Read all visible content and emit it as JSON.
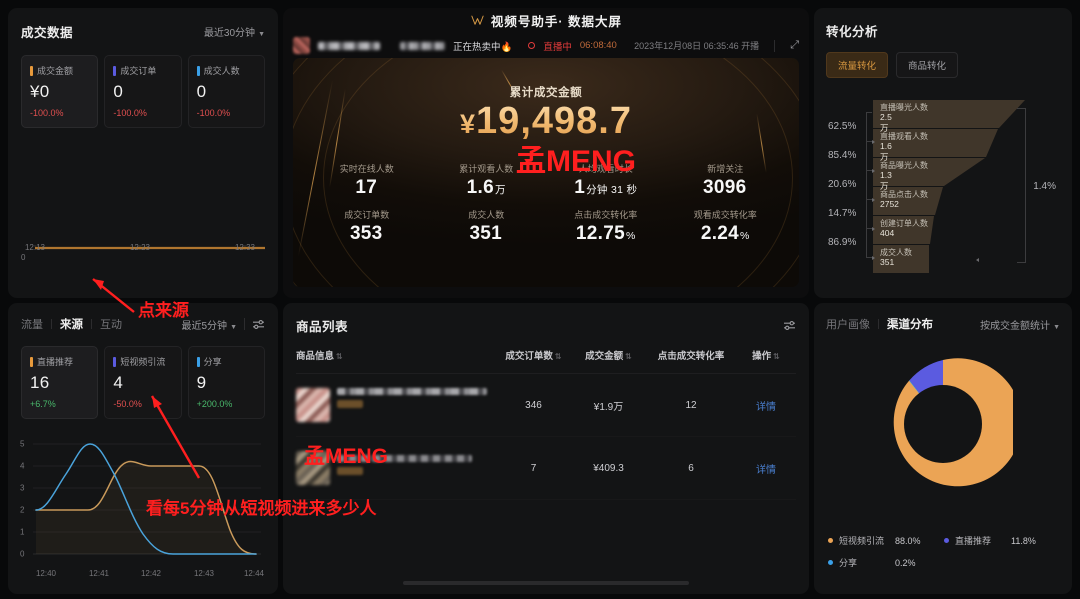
{
  "deal": {
    "title": "成交数据",
    "range": "最近30分钟",
    "cards": [
      {
        "label": "成交金额",
        "value": "¥0",
        "delta": "-100.0%",
        "dir": "down",
        "color": "#e89a3c"
      },
      {
        "label": "成交订单",
        "value": "0",
        "delta": "-100.0%",
        "dir": "down",
        "color": "#5b5be0"
      },
      {
        "label": "成交人数",
        "value": "0",
        "delta": "-100.0%",
        "dir": "down",
        "color": "#3aa0e8"
      }
    ],
    "spark_zero": "0",
    "spark_ticks": [
      "12:13",
      "12:23",
      "12:33"
    ]
  },
  "screen": {
    "brand": "视频号助手·  数据大屏",
    "hot_text": "正在热卖中🔥",
    "live_state": "直播中",
    "live_time": "06:08:40",
    "start_time": "2023年12月08日 06:35:46 开播",
    "gmv_label": "累计成交金额",
    "gmv_currency": "¥",
    "gmv_value": "19,498.7",
    "metrics": [
      {
        "label": "实时在线人数",
        "value": "17",
        "unit": ""
      },
      {
        "label": "累计观看人数",
        "value": "1.6",
        "unit": "万"
      },
      {
        "label": "人均观看时长",
        "value": "1",
        "unit": "分钟 31 秒"
      },
      {
        "label": "新增关注",
        "value": "3096",
        "unit": ""
      },
      {
        "label": "成交订单数",
        "value": "353",
        "unit": ""
      },
      {
        "label": "成交人数",
        "value": "351",
        "unit": ""
      },
      {
        "label": "点击成交转化率",
        "value": "12.75",
        "unit": "%"
      },
      {
        "label": "观看成交转化率",
        "value": "2.24",
        "unit": "%"
      }
    ]
  },
  "conversion": {
    "title": "转化分析",
    "tabs": [
      {
        "label": "流量转化",
        "active": true
      },
      {
        "label": "商品转化",
        "active": false
      }
    ],
    "total_rate": "1.4%",
    "steps": [
      {
        "name": "直播曝光人数",
        "value": "2.5万",
        "rate": "62.5%"
      },
      {
        "name": "直播观看人数",
        "value": "1.6万",
        "rate": "85.4%"
      },
      {
        "name": "商品曝光人数",
        "value": "1.3万",
        "rate": "20.6%"
      },
      {
        "name": "商品点击人数",
        "value": "2752",
        "rate": "14.7%"
      },
      {
        "name": "创建订单人数",
        "value": "404",
        "rate": "86.9%"
      },
      {
        "name": "成交人数",
        "value": "351",
        "rate": ""
      }
    ]
  },
  "source": {
    "tabs": [
      {
        "label": "流量",
        "active": false
      },
      {
        "label": "来源",
        "active": true
      },
      {
        "label": "互动",
        "active": false
      }
    ],
    "range": "最近5分钟",
    "cards": [
      {
        "label": "直播推荐",
        "value": "16",
        "delta": "+6.7%",
        "dir": "up",
        "color": "#e89a3c"
      },
      {
        "label": "短视频引流",
        "value": "4",
        "delta": "-50.0%",
        "dir": "down",
        "color": "#5b5be0"
      },
      {
        "label": "分享",
        "value": "9",
        "delta": "+200.0%",
        "dir": "up",
        "color": "#3aa0e8"
      }
    ],
    "chart_data": {
      "type": "line",
      "title": "",
      "xlabel": "",
      "ylabel": "",
      "x": [
        "12:40",
        "12:41",
        "12:42",
        "12:43",
        "12:44"
      ],
      "yticks": [
        0,
        1,
        2,
        3,
        4,
        5
      ],
      "ylim": [
        0,
        5
      ],
      "grid": true,
      "legend_position": "none",
      "series": [
        {
          "name": "直播推荐",
          "color": "#c99a5b",
          "values": [
            2,
            2,
            4,
            4,
            0
          ]
        },
        {
          "name": "短视频引流",
          "color": "#4aa3db",
          "values": [
            2,
            5,
            3,
            0,
            0
          ]
        }
      ]
    }
  },
  "goods": {
    "title": "商品列表",
    "columns": [
      "商品信息",
      "成交订单数",
      "成交金额",
      "点击成交转化率",
      "操作"
    ],
    "rows": [
      {
        "orders": "346",
        "amount": "¥1.9万",
        "conv": "12",
        "action": "详情"
      },
      {
        "orders": "7",
        "amount": "¥409.3",
        "conv": "6",
        "action": "详情"
      }
    ]
  },
  "channel": {
    "tabs": [
      {
        "label": "用户画像",
        "active": false
      },
      {
        "label": "渠道分布",
        "active": true
      }
    ],
    "range": "按成交金额统计",
    "chart_data": {
      "type": "pie",
      "title": "渠道分布",
      "legend_position": "bottom",
      "categories": [
        "短视频引流",
        "直播推荐",
        "分享"
      ],
      "values": [
        88.0,
        11.8,
        0.2
      ],
      "labels": [
        "88.0%",
        "11.8%",
        "0.2%"
      ],
      "colors": [
        "#eba455",
        "#5b5be0",
        "#3aa0e8"
      ]
    }
  },
  "annotations": {
    "watermark_1": "孟MENG",
    "watermark_2": "孟MENG",
    "note_1": "点来源",
    "note_2": "看每5分钟从短视频进来多少人"
  }
}
